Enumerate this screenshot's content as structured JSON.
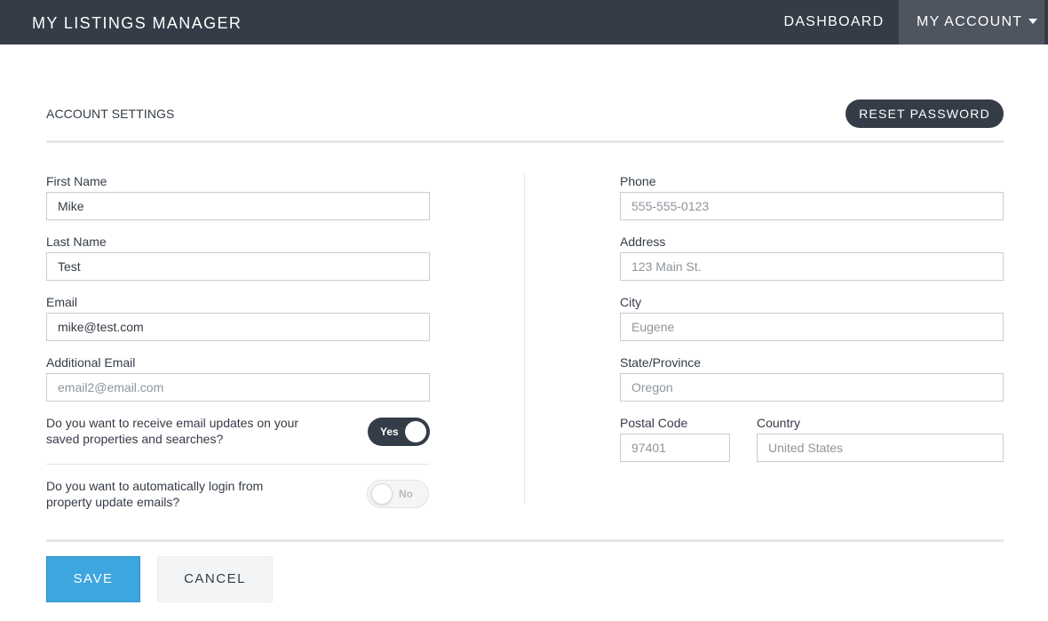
{
  "navbar": {
    "brand": "MY LISTINGS MANAGER",
    "links": [
      {
        "label": "DASHBOARD"
      },
      {
        "label": "MY ACCOUNT",
        "icon": "caret-down-icon"
      }
    ],
    "background": "#343c47"
  },
  "header": {
    "title": "ACCOUNT SETTINGS",
    "reset_label": "RESET PASSWORD"
  },
  "left": {
    "first_name": {
      "label": "First Name",
      "value": "Mike",
      "placeholder": ""
    },
    "last_name": {
      "label": "Last Name",
      "value": "Test",
      "placeholder": ""
    },
    "email": {
      "label": "Email",
      "value": "mike@test.com",
      "placeholder": ""
    },
    "additional_email": {
      "label": "Additional Email",
      "value": "",
      "placeholder": "email2@email.com"
    }
  },
  "right": {
    "phone": {
      "label": "Phone",
      "value": "",
      "placeholder": "555-555-0123"
    },
    "address": {
      "label": "Address",
      "value": "",
      "placeholder": "123 Main St."
    },
    "city": {
      "label": "City",
      "value": "",
      "placeholder": "Eugene"
    },
    "state": {
      "label": "State/Province",
      "value": "",
      "placeholder": "Oregon"
    },
    "postal": {
      "label": "Postal Code",
      "value": "",
      "placeholder": "97401"
    },
    "country": {
      "label": "Country",
      "value": "",
      "placeholder": "United States"
    }
  },
  "questions": {
    "email_updates": {
      "text": "Do you want to receive email updates on your saved properties and searches?",
      "toggle_label": "Yes",
      "enabled": true
    },
    "auto_login": {
      "text": "Do you want to automatically login from property update emails?",
      "toggle_label": "No",
      "enabled": false
    }
  },
  "actions": {
    "save_label": "SAVE",
    "cancel_label": "CANCEL"
  },
  "colors": {
    "dark": "#343c47",
    "accent": "#3ea6df",
    "account_tab": "#4e5560"
  }
}
